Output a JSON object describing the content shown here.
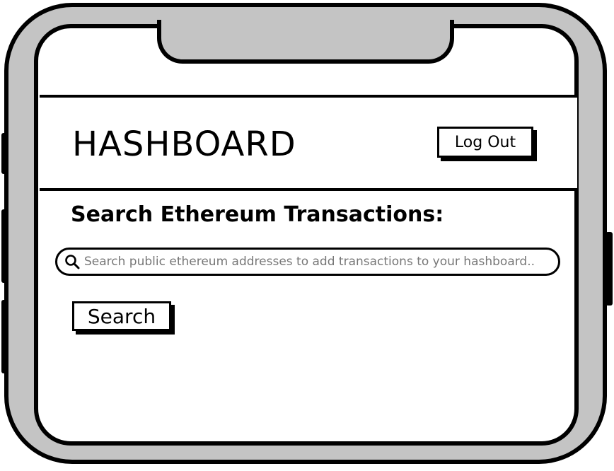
{
  "header": {
    "title": "HASHBOARD",
    "logout_label": "Log Out"
  },
  "search": {
    "heading": "Search Ethereum Transactions:",
    "placeholder": "Search public ethereum addresses to add transactions to your hashboard..",
    "value": "",
    "button_label": "Search",
    "icon": "search-icon"
  },
  "colors": {
    "device_frame": "#c4c4c4",
    "outline": "#000000",
    "screen": "#ffffff",
    "placeholder_text": "#777777"
  }
}
